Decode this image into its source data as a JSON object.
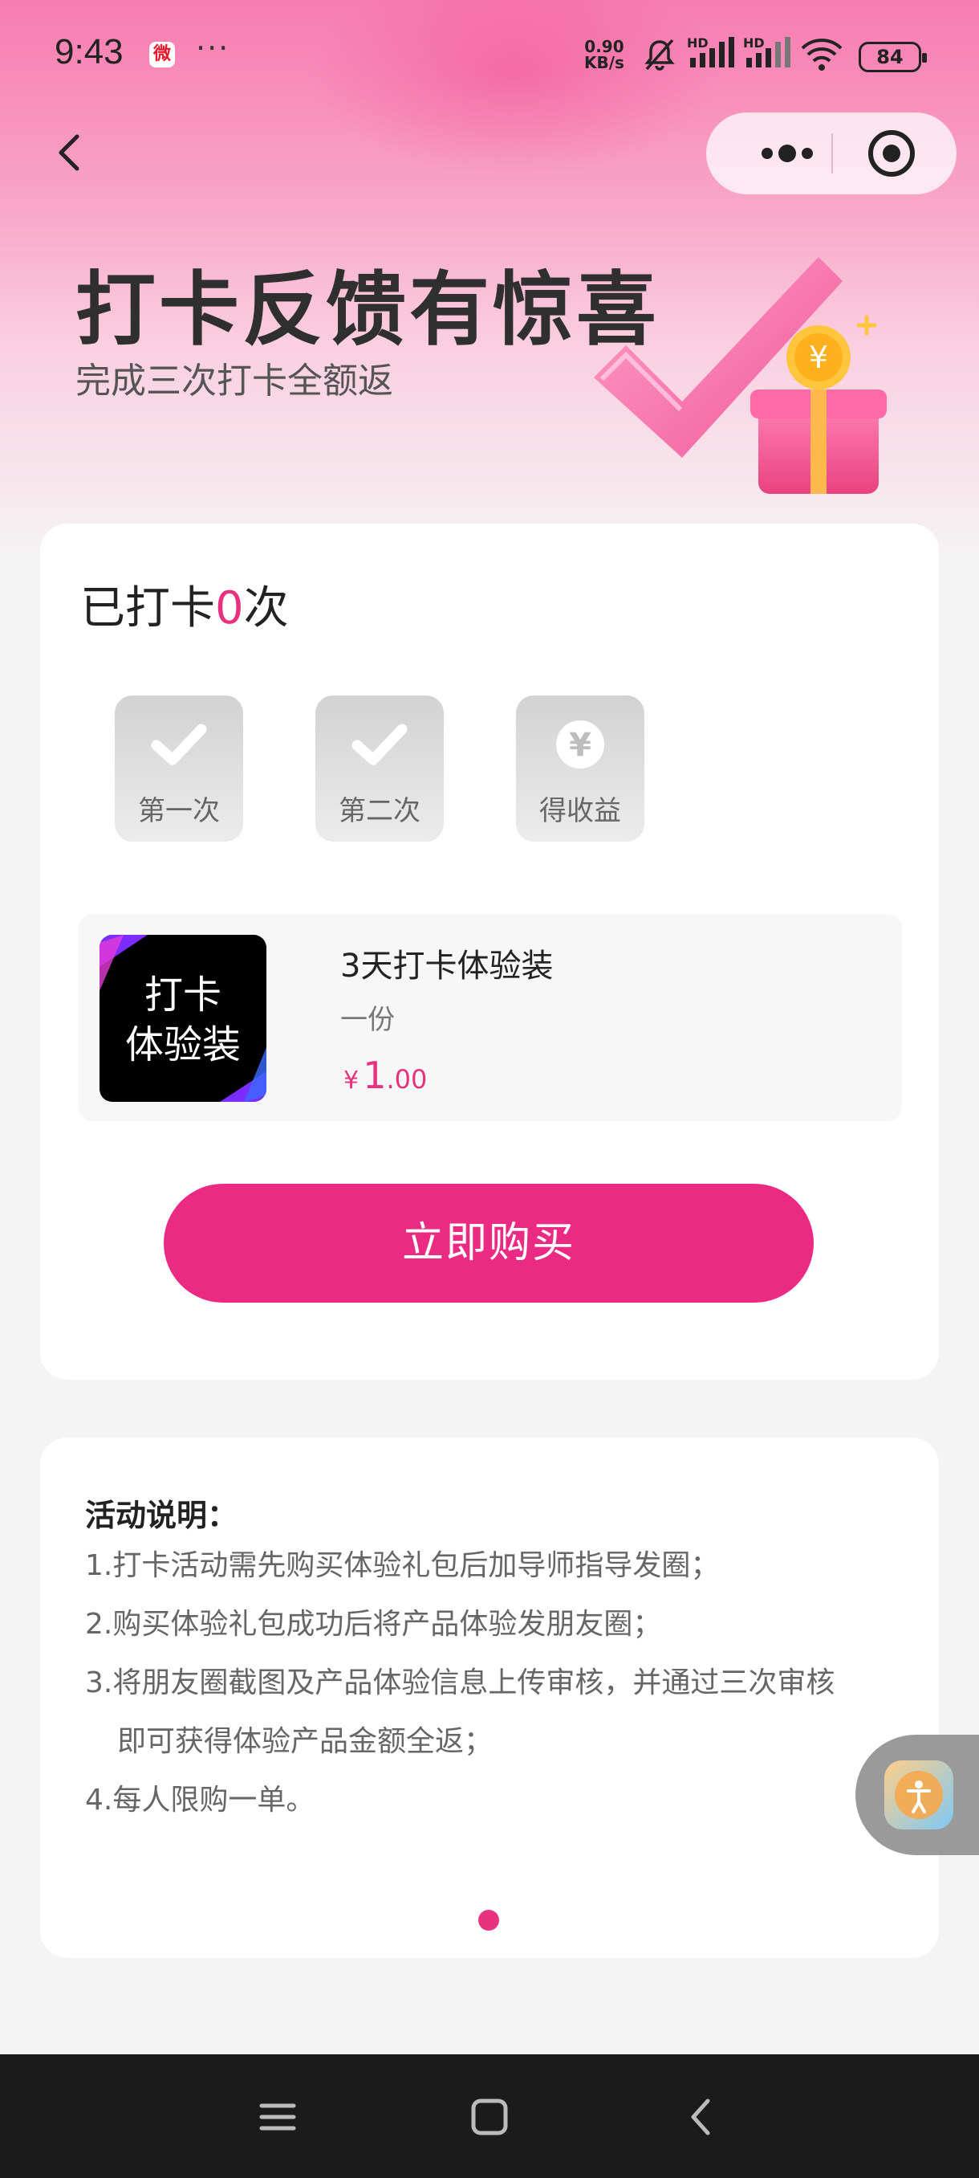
{
  "status_bar": {
    "time": "9:43",
    "weibo_label": "微",
    "overflow": "···",
    "net_speed_value": "0.90",
    "net_speed_unit": "KB/s",
    "hd_label": "HD",
    "battery": "84"
  },
  "hero": {
    "title": "打卡反馈有惊喜",
    "subtitle": "完成三次打卡全额返"
  },
  "checkin": {
    "prefix": "已打卡",
    "count": "0",
    "suffix": "次",
    "steps": [
      {
        "label": "第一次",
        "icon": "check-icon"
      },
      {
        "label": "第二次",
        "icon": "check-icon"
      },
      {
        "label": "得收益",
        "icon": "yuan-icon"
      }
    ]
  },
  "product": {
    "image_line1": "打卡",
    "image_line2": "体验装",
    "name": "3天打卡体验装",
    "quantity": "一份",
    "currency": "¥",
    "price_int": "1",
    "price_dec": ".00"
  },
  "buy_button": "立即购买",
  "rules": {
    "title": "活动说明：",
    "items": [
      "1.打卡活动需先购买体验礼包后加导师指导发圈；",
      "2.购买体验礼包成功后将产品体验发朋友圈；",
      "3.将朋友圈截图及产品体验信息上传审核，并通过三次审核",
      "即可获得体验产品金额全返；",
      "4.每人限购一单。"
    ]
  },
  "colors": {
    "accent": "#eb2b83",
    "price": "#e9327f"
  }
}
